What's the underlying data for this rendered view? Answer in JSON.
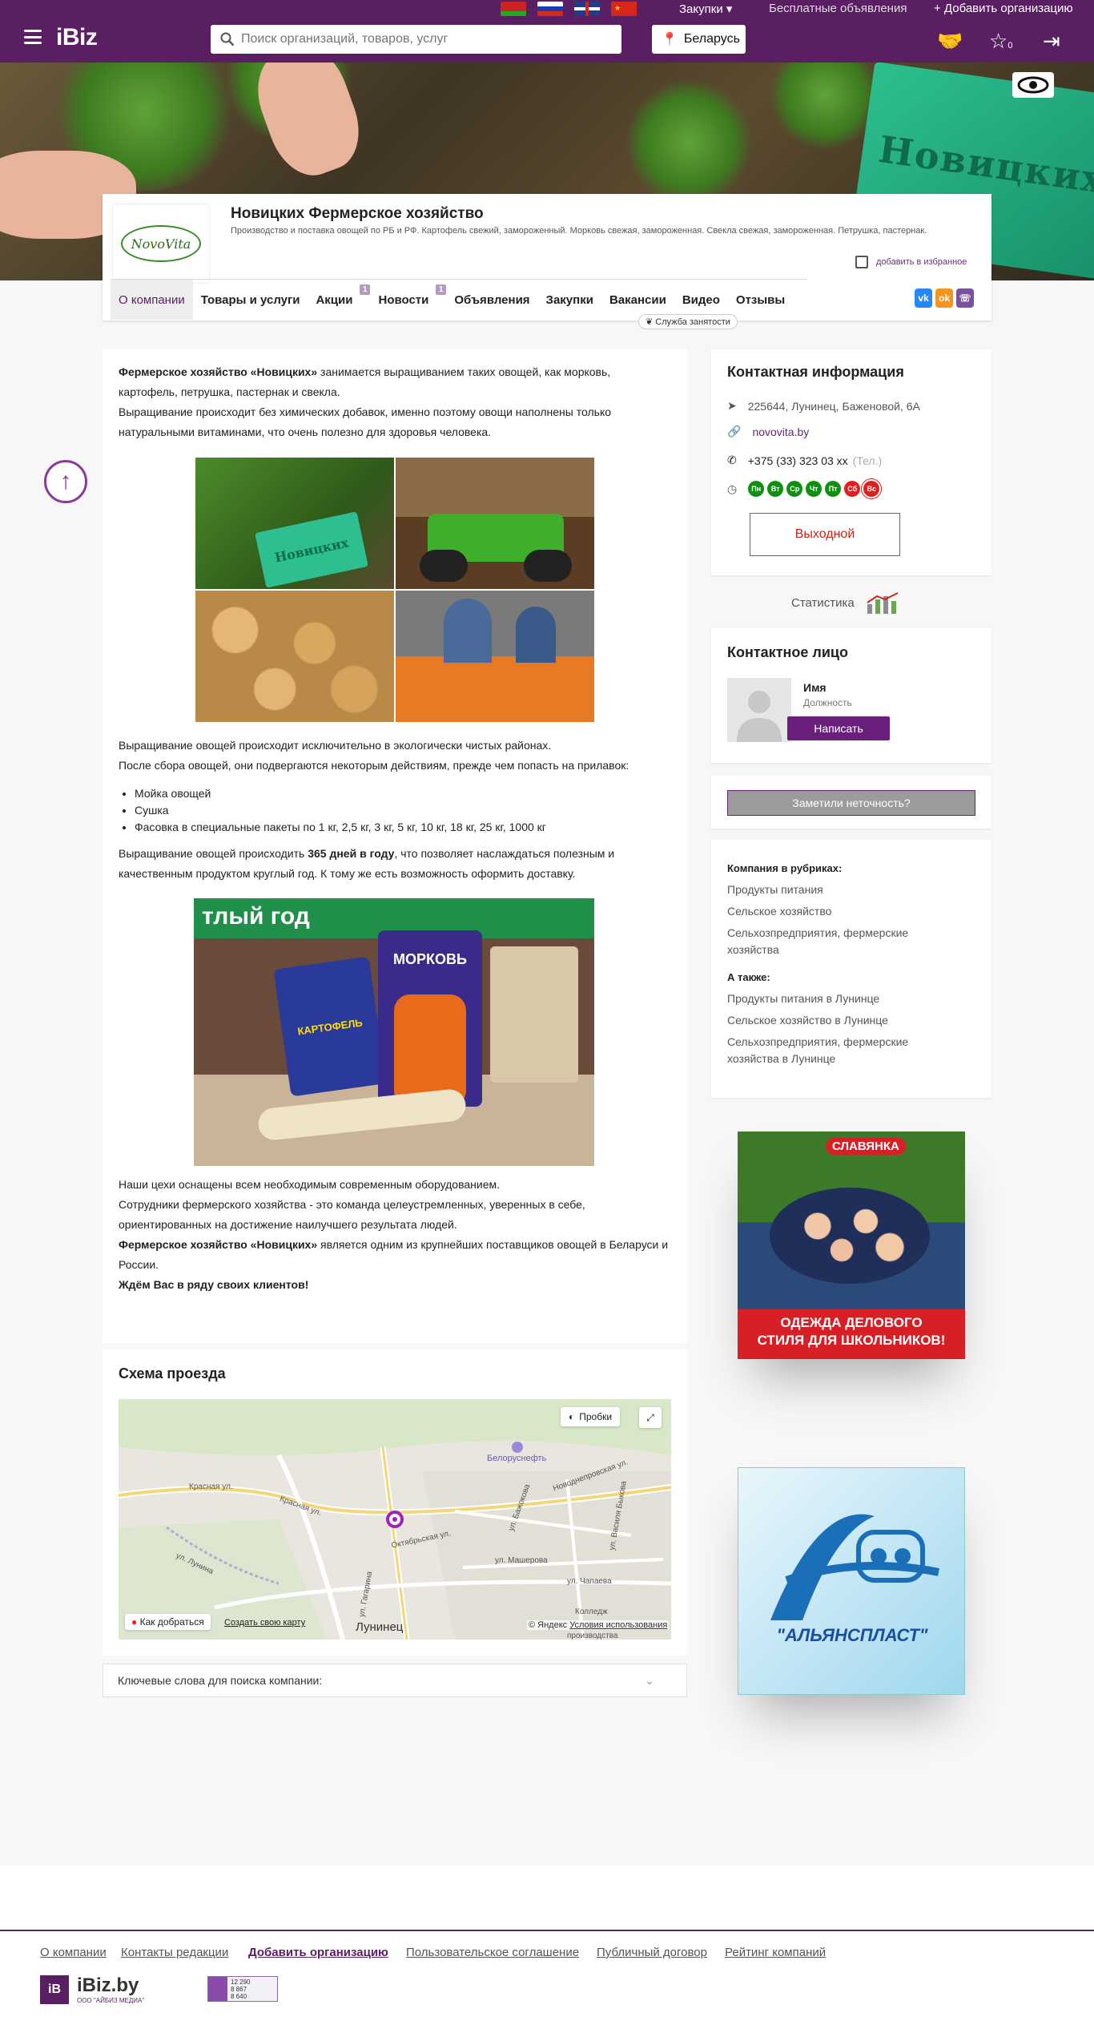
{
  "top": {
    "purchases": "Закупки",
    "free_ads": "Бесплатные объявления",
    "add_org": "+ Добавить организацию"
  },
  "header": {
    "logo": "iBiz",
    "search_placeholder": "Поиск организаций, товаров, услуг",
    "region": "Беларусь",
    "favorites_count": "0"
  },
  "company": {
    "logo_text": "NovoVita",
    "title": "Новицких Фермерское хозяйство",
    "description": "Производство и поставка овощей по РБ и РФ. Картофель свежий, замороженный. Морковь свежая, замороженная. Свекла свежая, замороженная. Петрушка, пастернак.",
    "add_favorite": "добавить в избранное",
    "banner_sign": "Новицких"
  },
  "tabs": [
    {
      "label": "О компании"
    },
    {
      "label": "Товары и услуги"
    },
    {
      "label": "Акции",
      "count": "1"
    },
    {
      "label": "Новости",
      "count": "1"
    },
    {
      "label": "Объявления"
    },
    {
      "label": "Закупки"
    },
    {
      "label": "Вакансии"
    },
    {
      "label": "Видео"
    },
    {
      "label": "Отзывы"
    }
  ],
  "sluzhba": "Служба занятости",
  "about": {
    "p1_bold": "Фермерское хозяйство «Новицких»",
    "p1_rest": " занимается выращиванием таких овощей, как морковь, картофель, петрушка, пастернак и свекла.",
    "p2": "Выращивание происходит без химических добавок, именно поэтому овощи наполнены только натуральными витаминами, что очень полезно для здоровья человека.",
    "collage_sign": "Новицких",
    "p3": "Выращивание овощей происходит исключительно в экологически чистых районах.",
    "p4": "После сбора овощей, они подвергаются некоторым действиям, прежде чем попасть на прилавок:",
    "list": [
      "Мойка овощей",
      "Сушка",
      "Фасовка в специальные пакеты по 1 кг, 2,5 кг, 3 кг, 5 кг, 10 кг, 18 кг, 25 кг, 1000 кг"
    ],
    "p5_a": "Выращивание овощей происходить ",
    "p5_b": "365 дней в году",
    "p5_c": ", что позволяет наслаждаться полезным и качественным продуктом круглый год. К тому же есть возможность оформить доставку.",
    "photo_texts": {
      "top": "тлый год",
      "bag": "МОРКОВЬ",
      "bag2": "КАРТОФЕЛЬ"
    },
    "p6": "Наши цехи оснащены всем необходимым современным оборудованием.",
    "p7": "Сотрудники фермерского хозяйства - это команда целеустремленных, уверенных в себе, ориентированных на достижение наилучшего результата людей.",
    "p8_bold": "Фермерское хозяйство «Новицких»",
    "p8_rest": " является одним из крупнейших поставщиков овощей в Беларуси и России.",
    "p9": "Ждём Вас в ряду своих клиентов!"
  },
  "map": {
    "title": "Схема проезда",
    "traffic": "Пробки",
    "route": "Как добраться",
    "create_map": "Создать свою карту",
    "city": "Лунинец",
    "copyright": "© Яндекс",
    "terms": "Условия использования",
    "labels": [
      "Белоруснефть",
      "Красная ул.",
      "Октябрьская ул.",
      "ул. Чапаева",
      "ул. Машерова",
      "Колледж",
      "ул. Бажокова",
      "ул. Василя Быкова",
      "Новоднепровская ул.",
      "ул. Гагарина",
      "Красная ул.",
      "ул. Лунина",
      "производства"
    ]
  },
  "keywords": "Ключевые слова для поиска компании:",
  "contacts": {
    "title": "Контактная информация",
    "address": "225644, Лунинец, Баженовой, 6А",
    "site": "novovita.by",
    "phone": "+375 (33) 323 03 xx",
    "phone_type": "(Тел.)",
    "days": [
      "Пн",
      "Вт",
      "Ср",
      "Чт",
      "Пт",
      "Сб",
      "Вс"
    ],
    "closed": "Выходной"
  },
  "stats": "Статистика",
  "person": {
    "title": "Контактное лицо",
    "name": "Имя",
    "position": "Должность",
    "write": "Написать"
  },
  "inaccurate": "Заметили неточность?",
  "rubrics": {
    "h1": "Компания в рубриках:",
    "items": [
      "Продукты питания",
      "Сельское хозяйство",
      "Сельхозпредприятия, фермерские хозяйства"
    ],
    "h2": "А также:",
    "also": [
      "Продукты питания в Лунинце",
      "Сельское хозяйство в Лунинце",
      "Сельхозпредприятия, фермерские хозяйства в Лунинце"
    ]
  },
  "ads": {
    "slav_brand": "СЛАВЯНКА",
    "slav_text": "ОДЕЖДА ДЕЛОВОГО СТИЛЯ ДЛЯ ШКОЛЬНИКОВ!",
    "alyans": "\"АЛЬЯНСПЛАСТ\""
  },
  "footer": {
    "links": [
      "О компании",
      "Контакты редакции",
      "Добавить организацию",
      "Пользовательское соглашение",
      "Публичный договор",
      "Рейтинг компаний"
    ],
    "logo": "iBiz.by",
    "logo_sub": "ООО \"АЙБИЗ МЕДИА\"",
    "counter": [
      "12 290",
      "8 867",
      "8 640"
    ]
  }
}
